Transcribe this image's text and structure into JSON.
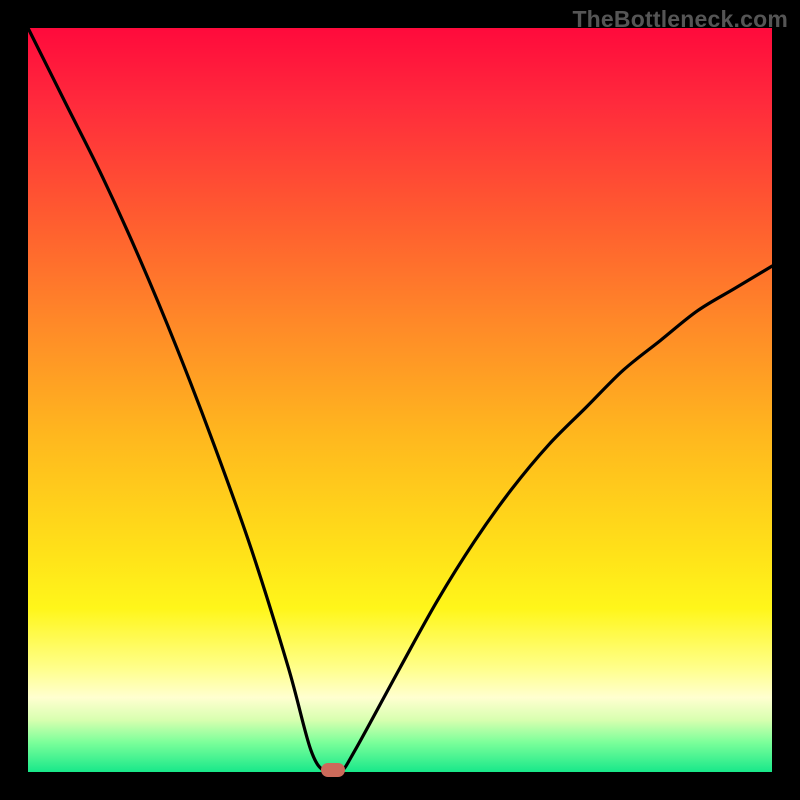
{
  "watermark": {
    "text": "TheBottleneck.com"
  },
  "colors": {
    "curve_stroke": "#000000",
    "marker_fill": "#cc6a5a",
    "frame_bg": "#000000"
  },
  "chart_data": {
    "type": "line",
    "title": "",
    "xlabel": "",
    "ylabel": "",
    "xlim": [
      0,
      100
    ],
    "ylim": [
      0,
      100
    ],
    "grid": false,
    "x": [
      0,
      5,
      10,
      15,
      20,
      25,
      30,
      35,
      38,
      40,
      42,
      44,
      50,
      55,
      60,
      65,
      70,
      75,
      80,
      85,
      90,
      95,
      100
    ],
    "y": [
      100,
      90,
      80,
      69,
      57,
      44,
      30,
      14,
      3,
      0,
      0,
      3,
      14,
      23,
      31,
      38,
      44,
      49,
      54,
      58,
      62,
      65,
      68
    ],
    "sweet_spot": {
      "x": 41,
      "y": 0
    },
    "legend": []
  }
}
